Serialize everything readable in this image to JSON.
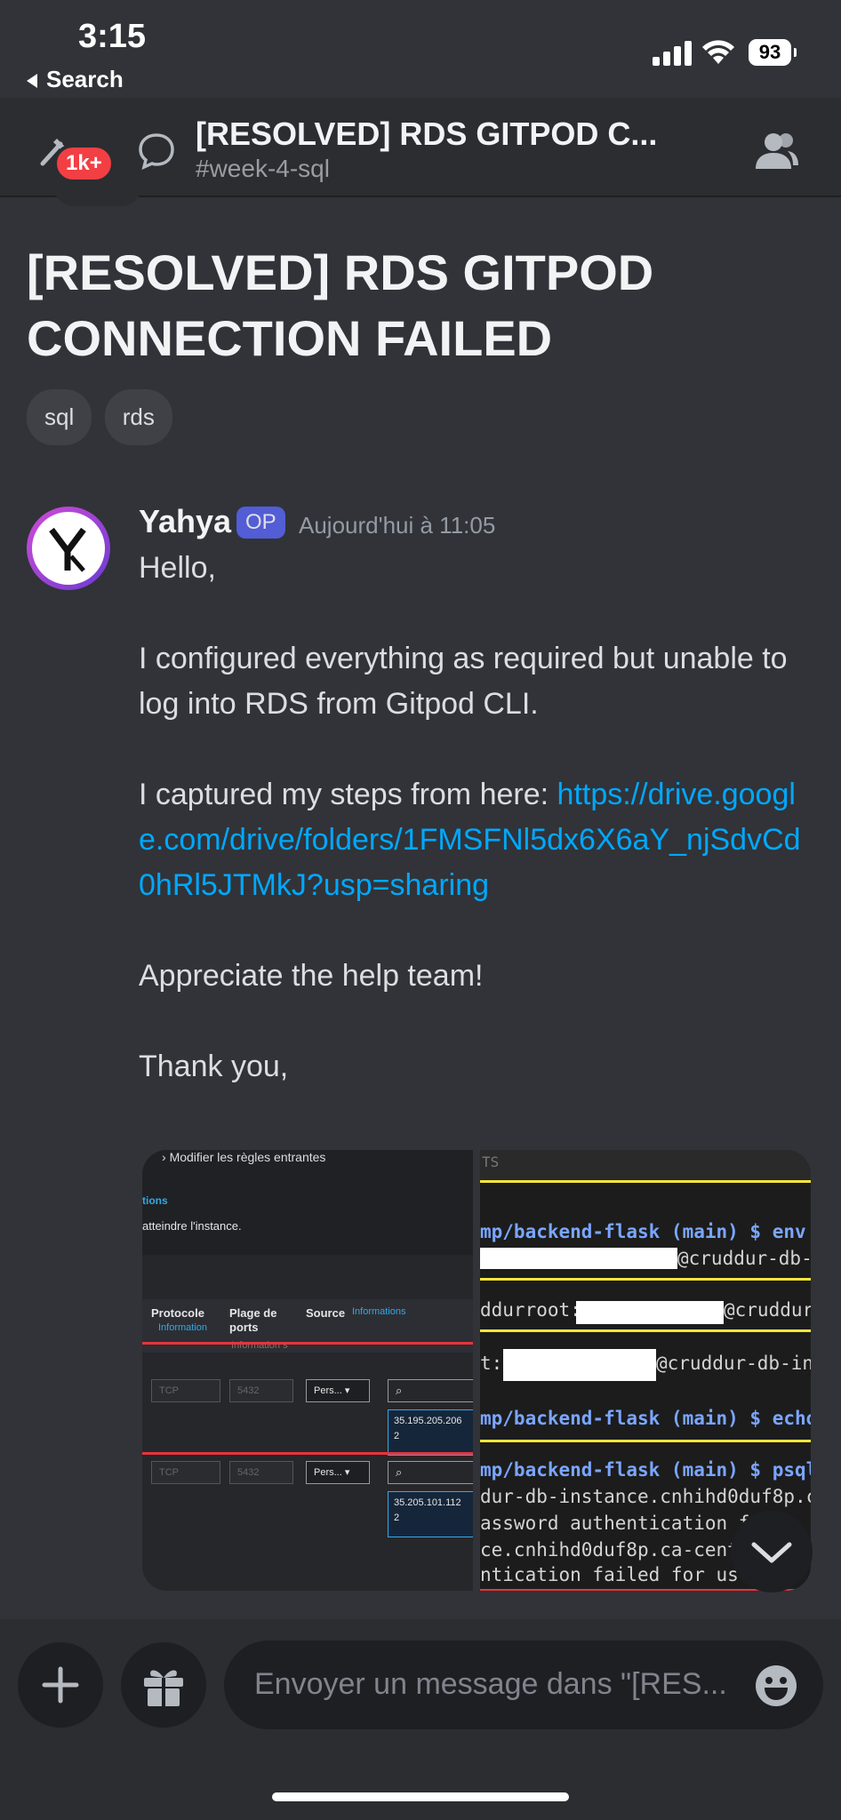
{
  "status": {
    "time": "3:15",
    "back_label": "Search",
    "battery": "93"
  },
  "header": {
    "badge": "1k+",
    "title": "[RESOLVED] RDS GITPOD C...",
    "channel": "#week-4-sql"
  },
  "post": {
    "title": "[RESOLVED] RDS GITPOD CONNECTION FAILED",
    "tags": [
      "sql",
      "rds"
    ]
  },
  "message": {
    "author": "Yahya",
    "op_badge": "OP",
    "timestamp": "Aujourd'hui à 11:05",
    "lines": {
      "greeting": "Hello,",
      "p1": "I configured everything as required but unable to log into RDS from Gitpod CLI.",
      "p2_prefix": "I captured my steps from here: ",
      "p2_link": "https://drive.google.com/drive/folders/1FMSFNl5dx6X6aY_njSdvCd0hRl5JTMkJ?usp=sharing",
      "p3": "Appreciate the help team!",
      "p4": "Thank you,"
    }
  },
  "attachment_console": {
    "header_text": "Modifier les règles entrantes",
    "tions": "tions",
    "reach": "atteindre l'instance.",
    "col_protocol": "Protocole",
    "col_protocol_info": "Information",
    "col_ports": "Plage de ports",
    "col_ports_info": "Information s",
    "col_source": "Source",
    "col_source_info": "Informations",
    "rows": [
      {
        "protocol": "TCP",
        "port": "5432",
        "source": "Pers...",
        "ip": "35.195.205.206",
        "mask": "2"
      },
      {
        "protocol": "TCP",
        "port": "5432",
        "source": "Pers...",
        "ip": "35.205.101.112",
        "mask": "2"
      }
    ]
  },
  "attachment_terminal": {
    "header": "TS",
    "lines": [
      "mp/backend-flask (main) $ env",
      "@cruddur-db-",
      "ddurroot:",
      "@cruddur",
      "t:",
      "@cruddur-db-in",
      "mp/backend-flask (main) $ echo",
      "mp/backend-flask (main) $ psql",
      "dur-db-instance.cnhihd0duf8p.c",
      "assword authentication f",
      "ce.cnhihd0duf8p.ca-cent",
      "ntication failed for us"
    ]
  },
  "composer": {
    "placeholder": "Envoyer un message dans \"[RES..."
  }
}
